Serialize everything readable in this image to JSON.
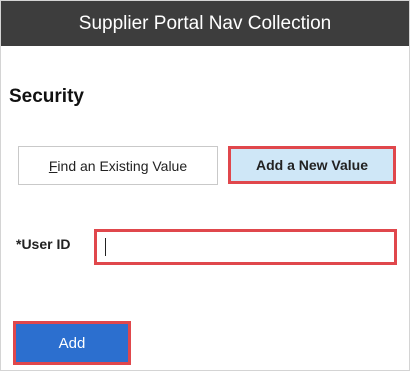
{
  "header": {
    "title": "Supplier Portal Nav Collection"
  },
  "page": {
    "title": "Security"
  },
  "tabs": {
    "find_existing_first": "F",
    "find_existing_rest": "ind an Existing Value",
    "add_new": "Add a New Value"
  },
  "form": {
    "user_id_label": "*User ID",
    "user_id_value": ""
  },
  "actions": {
    "add_label": "Add"
  },
  "colors": {
    "header_bg": "#3d3d3d",
    "active_tab_bg": "#cfe7f7",
    "highlight_border": "#e0474c",
    "primary_button": "#2c6fcf"
  }
}
